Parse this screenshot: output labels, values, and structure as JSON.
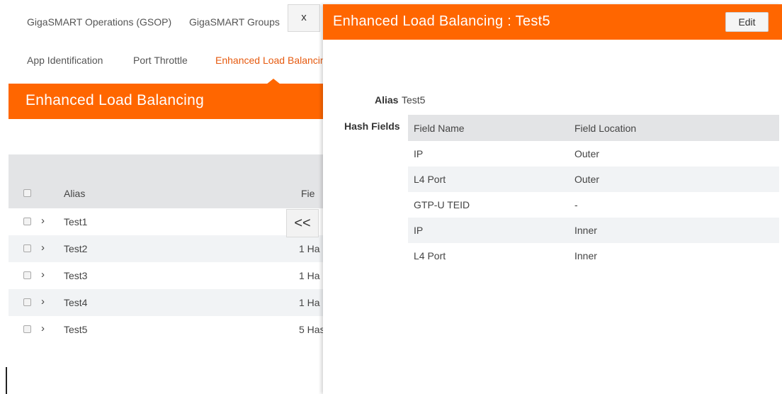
{
  "top_tabs": [
    "GigaSMART Operations (GSOP)",
    "GigaSMART Groups"
  ],
  "sub_tabs": [
    "App Identification",
    "Port Throttle",
    "Enhanced Load Balancing"
  ],
  "panel": {
    "title": "Enhanced Load Balancing"
  },
  "grid": {
    "columns": {
      "alias": "Alias",
      "fields": "Fie"
    },
    "rows": [
      {
        "alias": "Test1",
        "fields": ""
      },
      {
        "alias": "Test2",
        "fields": "1 Ha"
      },
      {
        "alias": "Test3",
        "fields": "1 Ha"
      },
      {
        "alias": "Test4",
        "fields": "1 Ha"
      },
      {
        "alias": "Test5",
        "fields": "5 Has"
      }
    ]
  },
  "collapse_label": "<<",
  "close_label": "x",
  "detail": {
    "title": "Enhanced Load Balancing : Test5",
    "edit_label": "Edit",
    "alias_label": "Alias",
    "alias_value": "Test5",
    "hash_fields_label": "Hash Fields",
    "hash_columns": {
      "name": "Field Name",
      "location": "Field Location"
    },
    "hash_rows": [
      {
        "name": "IP",
        "location": "Outer"
      },
      {
        "name": "L4 Port",
        "location": "Outer"
      },
      {
        "name": "GTP-U TEID",
        "location": "-"
      },
      {
        "name": "IP",
        "location": "Inner"
      },
      {
        "name": "L4 Port",
        "location": "Inner"
      }
    ]
  },
  "colors": {
    "accent": "#ff6600",
    "active_tab": "#e65a0f",
    "header_gray": "#e3e4e6",
    "row_alt": "#f1f3f5"
  }
}
